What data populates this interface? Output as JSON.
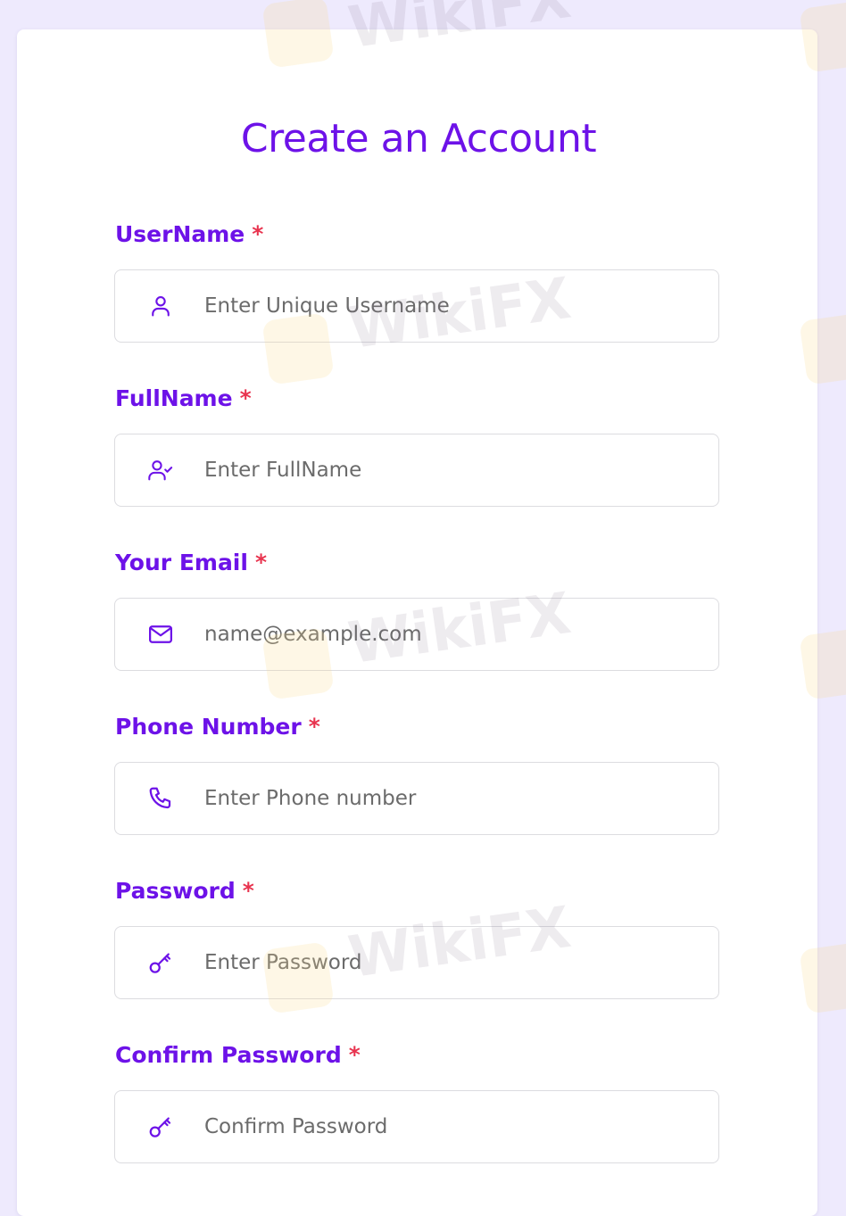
{
  "form": {
    "title": "Create an Account",
    "required_marker": "*",
    "fields": [
      {
        "label": "UserName",
        "placeholder": "Enter Unique Username",
        "icon": "user-icon"
      },
      {
        "label": "FullName",
        "placeholder": "Enter FullName",
        "icon": "user-check-icon"
      },
      {
        "label": "Your Email",
        "placeholder": "name@example.com",
        "icon": "mail-icon"
      },
      {
        "label": "Phone Number",
        "placeholder": "Enter Phone number",
        "icon": "phone-icon"
      },
      {
        "label": "Password",
        "placeholder": "Enter Password",
        "icon": "key-icon"
      },
      {
        "label": "Confirm Password",
        "placeholder": "Confirm Password",
        "icon": "key-icon"
      }
    ]
  },
  "watermark": {
    "text": "WikiFX"
  },
  "colors": {
    "accent": "#6d12e8",
    "required": "#e8344f",
    "background": "#eeeafd",
    "placeholder": "#6b6b6b"
  }
}
